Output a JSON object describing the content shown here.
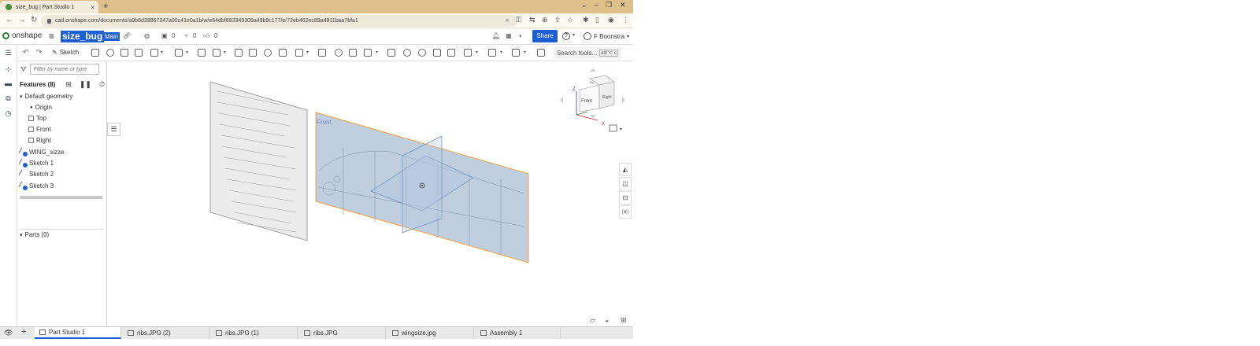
{
  "browser": {
    "tab_title": "size_bug | Part Studio 1",
    "new_tab": "+",
    "url": "cad.onshape.com/documents/a9b6d39967247a00c41e0a1b/w/e64dbf683349309a49b9c177/e/72eb462ec89a4911baa7bfa1"
  },
  "header": {
    "logo_text": "onshape",
    "doc_name": "size_bug",
    "branch": "Main",
    "versions_count": "0",
    "branches_count": "0",
    "likes_count": "0",
    "share_label": "Share",
    "help_label": "?",
    "user_name": "F Boonstra"
  },
  "toolbar": {
    "sketch_label": "Sketch",
    "search_label": "Search tools...",
    "search_shortcut": "alt/⌥ c"
  },
  "features": {
    "filter_placeholder": "Filter by name or type",
    "title": "Features (8)",
    "default_geometry": "Default geometry",
    "origin": "Origin",
    "top": "Top",
    "front": "Front",
    "right": "Right",
    "items": [
      "WING_sizze",
      "Sketch 1",
      "Sketch 2",
      "Sketch 3"
    ],
    "parts_label": "Parts (0)"
  },
  "viewport": {
    "plane_label": "Front",
    "cube": {
      "top": "Top",
      "front": "Front",
      "right": "Right",
      "axis_x": "X",
      "axis_z": "Z"
    }
  },
  "bottom_tabs": [
    "Part Studio 1",
    "ribs.JPG (2)",
    "ribs.JPG (1)",
    "ribs.JPG",
    "wingsize.jpg",
    "Assembly 1"
  ],
  "colors": {
    "accent": "#1f5fd6",
    "browser_frame": "#dfc08a",
    "selection_orange": "#f0a040",
    "plane_fill": "#a9bfd6"
  }
}
